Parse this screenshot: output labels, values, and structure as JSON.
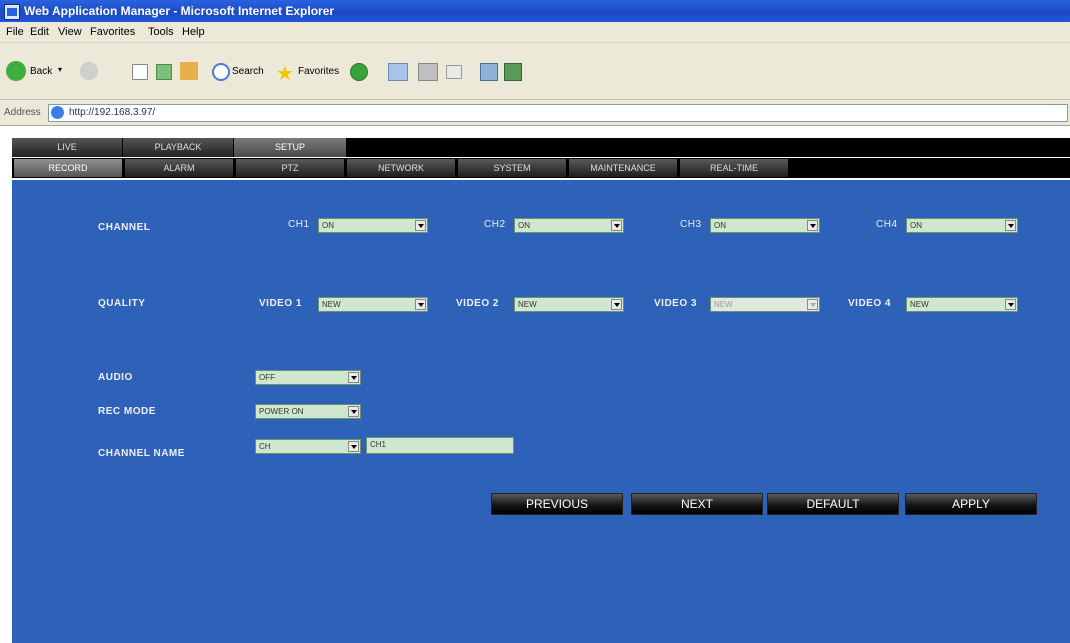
{
  "window": {
    "title": "Web Application Manager - Microsoft Internet Explorer"
  },
  "menu": [
    "File",
    "Edit",
    "View",
    "Favorites",
    "Tools",
    "Help"
  ],
  "toolbar": {
    "back_label": "Back",
    "search_label": "Search",
    "favorites_label": "Favorites"
  },
  "address": {
    "label": "Address",
    "url": "http://192.168.3.97/"
  },
  "main_tabs": [
    "LIVE",
    "PLAYBACK",
    "SETUP"
  ],
  "main_tab_active": "SETUP",
  "sub_tabs": [
    "RECORD",
    "ALARM",
    "PTZ",
    "NETWORK",
    "SYSTEM",
    "MAINTENANCE",
    "REAL-TIME"
  ],
  "sub_tab_active": "RECORD",
  "form": {
    "channel": {
      "label": "CHANNEL",
      "items": [
        {
          "name": "CH1",
          "value": "ON"
        },
        {
          "name": "CH2",
          "value": "ON"
        },
        {
          "name": "CH3",
          "value": "ON"
        },
        {
          "name": "CH4",
          "value": "ON"
        }
      ]
    },
    "quality": {
      "label": "QUALITY",
      "items": [
        {
          "name": "VIDEO 1",
          "value": "NEW"
        },
        {
          "name": "VIDEO 2",
          "value": "NEW"
        },
        {
          "name": "VIDEO 3",
          "value": "NEW"
        },
        {
          "name": "VIDEO 4",
          "value": "NEW"
        }
      ]
    },
    "audio": {
      "label": "AUDIO",
      "value": "OFF"
    },
    "rec_mode": {
      "label": "REC MODE",
      "value": "POWER ON"
    },
    "channel_name": {
      "label": "CHANNEL NAME",
      "select_value": "CH",
      "text_value": "CH1"
    }
  },
  "buttons": {
    "previous": "PREVIOUS",
    "next": "NEXT",
    "default": "DEFAULT",
    "apply": "APPLY"
  },
  "colors": {
    "panel": "#2e62b8",
    "title_bar": "#1a49c4",
    "field": "#cfe7cf"
  }
}
